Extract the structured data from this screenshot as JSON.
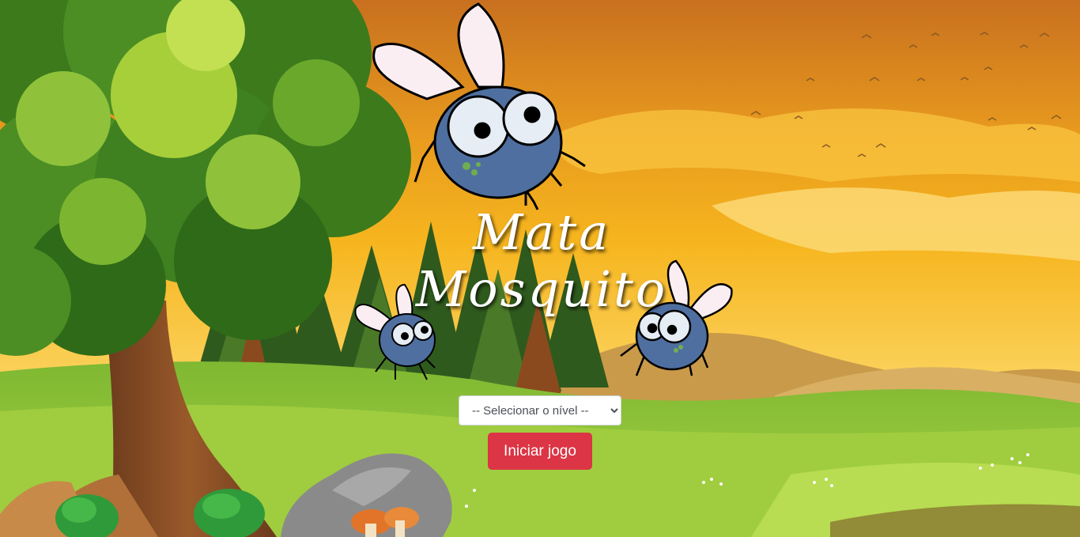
{
  "game": {
    "title_line1": "Mata",
    "title_line2": "Mosquito",
    "level_select": {
      "selected": "-- Selecionar o nível --"
    },
    "start_button_label": "Iniciar jogo"
  },
  "colors": {
    "start_button": "#dc3545",
    "sky_top": "#c8701f",
    "sky_mid": "#f6b51e",
    "grass": "#8fc43a",
    "mosquito_body": "#4f6fa0"
  }
}
